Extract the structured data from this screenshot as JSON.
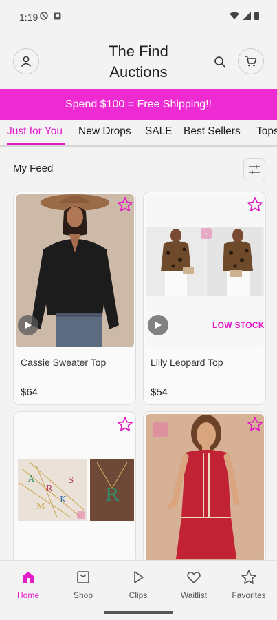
{
  "status_bar": {
    "time": "1:19"
  },
  "header": {
    "brand_line1": "The Find",
    "brand_line2": "Auctions"
  },
  "promo": {
    "text": "Spend $100 = Free Shipping!!"
  },
  "tabs": [
    {
      "label": "Just for You",
      "active": true
    },
    {
      "label": "New Drops"
    },
    {
      "label": "SALE"
    },
    {
      "label": "Best Sellers"
    },
    {
      "label": "Tops"
    }
  ],
  "feed": {
    "title": "My Feed"
  },
  "products": [
    {
      "name": "Cassie Sweater Top",
      "price": "$64",
      "badge": ""
    },
    {
      "name": "Lilly Leopard Top",
      "price": "$54",
      "badge": "LOW STOCK"
    },
    {
      "name": "",
      "price": "",
      "badge": ""
    },
    {
      "name": "",
      "price": "",
      "badge": ""
    }
  ],
  "bottom_nav": [
    {
      "label": "Home",
      "icon": "home-icon",
      "active": true
    },
    {
      "label": "Shop",
      "icon": "shop-icon"
    },
    {
      "label": "Clips",
      "icon": "play-icon"
    },
    {
      "label": "Waitlist",
      "icon": "heart-icon"
    },
    {
      "label": "Favorites",
      "icon": "star-icon"
    }
  ],
  "colors": {
    "accent": "#e21cc6",
    "banner": "#ee2ad2",
    "background": "#f3f3f4"
  }
}
